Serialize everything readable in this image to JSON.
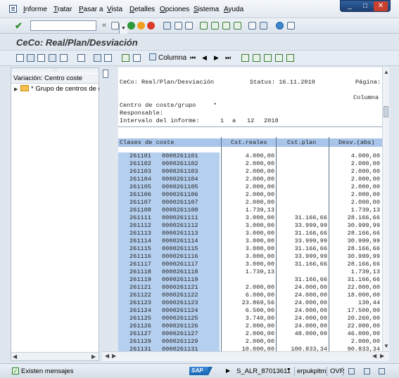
{
  "menu": {
    "items": [
      "Informe",
      "Tratar",
      "Pasar a",
      "Vista",
      "Detalles",
      "Opciones",
      "Sistema",
      "Ayuda"
    ]
  },
  "window_controls": {
    "minimize": "_",
    "maximize": "□",
    "close": "✕"
  },
  "toolbar": {
    "back_arrows": "«"
  },
  "title": "CeCo: Real/Plan/Desviación",
  "app_toolbar": {
    "columna_label": "Columna"
  },
  "tree": {
    "header": "Variación: Centro coste",
    "node": "* Grupo de centros de co"
  },
  "report": {
    "title_line": "CeCo: Real/Plan/Desviación",
    "status_label": "Status: 16.11.2019",
    "page_label": "Página:",
    "column_label": "Columna",
    "cost_center_label": "Centro de coste/grupo",
    "cost_center_value": "*",
    "responsible_label": "Responsable:",
    "interval_label": "Intervalo del informe:",
    "interval_from": "1",
    "interval_sep": "a",
    "interval_to": "12",
    "interval_year": "2018",
    "columns": {
      "cost_class": "Clases de coste",
      "actual": "Cst.reales",
      "plan": "Cst.plan",
      "deviation": "Desv.(abs)"
    },
    "rows": [
      {
        "cls": "261101",
        "code": "0000261101",
        "actual": "4.000,00",
        "plan": "",
        "dev": "4.000,00"
      },
      {
        "cls": "261102",
        "code": "0000261102",
        "actual": "2.000,00",
        "plan": "",
        "dev": "2.000,00"
      },
      {
        "cls": "261103",
        "code": "0000261103",
        "actual": "2.000,00",
        "plan": "",
        "dev": "2.000,00"
      },
      {
        "cls": "261104",
        "code": "0000261104",
        "actual": "2.000,00",
        "plan": "",
        "dev": "2.000,00"
      },
      {
        "cls": "261105",
        "code": "0000261105",
        "actual": "2.000,00",
        "plan": "",
        "dev": "2.000,00"
      },
      {
        "cls": "261106",
        "code": "0000261106",
        "actual": "2.000,00",
        "plan": "",
        "dev": "2.000,00"
      },
      {
        "cls": "261107",
        "code": "0000261107",
        "actual": "2.000,00",
        "plan": "",
        "dev": "2.000,00"
      },
      {
        "cls": "261108",
        "code": "0000261108",
        "actual": "1.739,13",
        "plan": "",
        "dev": "1.739,13"
      },
      {
        "cls": "261111",
        "code": "0000261111",
        "actual": "3.000,00",
        "plan": "31.166,66",
        "dev": "28.166,66"
      },
      {
        "cls": "261112",
        "code": "0000261112",
        "actual": "3.000,00",
        "plan": "33.999,99",
        "dev": "30.999,99"
      },
      {
        "cls": "261113",
        "code": "0000261113",
        "actual": "3.000,00",
        "plan": "31.166,66",
        "dev": "28.166,66"
      },
      {
        "cls": "261114",
        "code": "0000261114",
        "actual": "3.000,00",
        "plan": "33.999,99",
        "dev": "30.999,99"
      },
      {
        "cls": "261115",
        "code": "0000261115",
        "actual": "3.000,00",
        "plan": "31.166,66",
        "dev": "28.166,66"
      },
      {
        "cls": "261116",
        "code": "0000261116",
        "actual": "3.000,00",
        "plan": "33.999,99",
        "dev": "30.999,99"
      },
      {
        "cls": "261117",
        "code": "0000261117",
        "actual": "3.000,00",
        "plan": "31.166,66",
        "dev": "28.166,66"
      },
      {
        "cls": "261118",
        "code": "0000261118",
        "actual": "1.739,13",
        "plan": "",
        "dev": "1.739,13"
      },
      {
        "cls": "261119",
        "code": "0000261119",
        "actual": "",
        "plan": "31.166,66",
        "dev": "31.166,66"
      },
      {
        "cls": "261121",
        "code": "0000261121",
        "actual": "2.000,00",
        "plan": "24.000,00",
        "dev": "22.000,00"
      },
      {
        "cls": "261122",
        "code": "0000261122",
        "actual": "6.000,00",
        "plan": "24.000,00",
        "dev": "18.000,00"
      },
      {
        "cls": "261123",
        "code": "0000261123",
        "actual": "23.869,56",
        "plan": "24.000,00",
        "dev": "130,44"
      },
      {
        "cls": "261124",
        "code": "0000261124",
        "actual": "6.500,00",
        "plan": "24.000,00",
        "dev": "17.500,00"
      },
      {
        "cls": "261125",
        "code": "0000261125",
        "actual": "3.740,00",
        "plan": "24.000,00",
        "dev": "20.260,00"
      },
      {
        "cls": "261126",
        "code": "0000261126",
        "actual": "2.000,00",
        "plan": "24.000,00",
        "dev": "22.000,00"
      },
      {
        "cls": "261127",
        "code": "0000261127",
        "actual": "2.000,00",
        "plan": "48.000,00",
        "dev": "46.000,00"
      },
      {
        "cls": "261129",
        "code": "0000261129",
        "actual": "2.000,00",
        "plan": "",
        "dev": "2.000,00"
      },
      {
        "cls": "261131",
        "code": "0000261131",
        "actual": "10.000,00",
        "plan": "100.833,34",
        "dev": "90.833,34"
      }
    ]
  },
  "status_bar": {
    "message": "Existen mensajes",
    "sap_logo": "SAP",
    "transaction": "S_ALR_87013611",
    "user": "erpukpltm",
    "mode": "OVR"
  },
  "colors": {
    "key_cell": "#b5cfee",
    "header_row": "#a9c6ea",
    "title": "#333333",
    "window_controls": "#1d3f72"
  }
}
